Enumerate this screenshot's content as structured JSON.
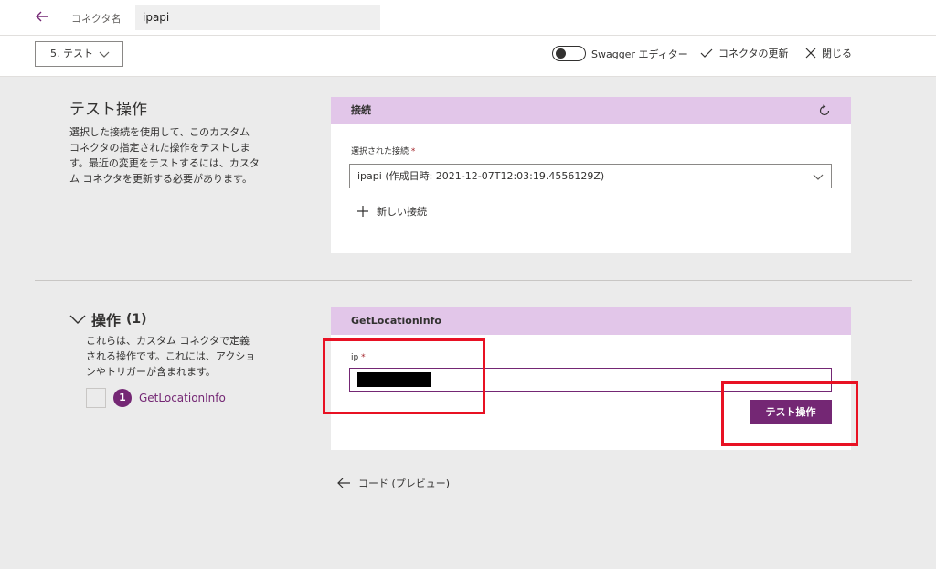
{
  "header": {
    "connector_name_label": "コネクタ名",
    "connector_name_value": "ipapi"
  },
  "toolbar": {
    "step_label": "5. テスト",
    "swagger_label": "Swagger エディター",
    "swagger_enabled": false,
    "update_label": "コネクタの更新",
    "close_label": "閉じる"
  },
  "test_section": {
    "title": "テスト操作",
    "description": "選択した接続を使用して、このカスタム コネクタの指定された操作をテストします。最近の変更をテストするには、カスタム コネクタを更新する必要があります。",
    "card_header": "接続",
    "selected_connection_label": "選択された接続",
    "required_mark": "*",
    "selected_connection_value": "ipapi (作成日時: 2021-12-07T12:03:19.4556129Z)",
    "new_connection_label": "新しい接続"
  },
  "operations": {
    "title": "操作",
    "count": "(1)",
    "description": "これらは、カスタム コネクタで定義される操作です。これには、アクションやトリガーが含まれます。",
    "items": [
      {
        "number": "1",
        "name": "GetLocationInfo"
      }
    ],
    "card_header": "GetLocationInfo",
    "ip_label": "ip",
    "required_mark": "*",
    "test_button_label": "テスト操作"
  },
  "footer": {
    "code_preview_label": "コード (プレビュー)"
  },
  "colors": {
    "accent": "#742774",
    "card_header_bg": "#e2c6e9",
    "highlight": "#e81123",
    "page_bg": "#ebebeb"
  }
}
